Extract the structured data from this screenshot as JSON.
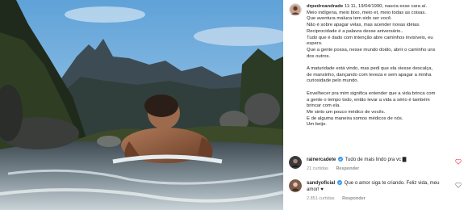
{
  "post": {
    "username": "drpedroandrade",
    "caption_lines": [
      "11:11, 19/04/1990, nascia esse cara aí.",
      "Meio indígena, meio bixo, meio et, meio todas as coisas.",
      "Que aventura maluca tem sido ser você.",
      "Não é sobre apagar velas, mas acender novas idéias.",
      "Reciprocidade é a palavra desse aniversário..",
      "Tudo que é dado com intenção abre caminhos invisíveis, eu",
      "espero.",
      "Que a gente possa, nesse mundo doido, abrir o caminho uns",
      "dos outros.",
      "",
      "A maturidade está vindo, mas pedi que ela viesse descalça,",
      "de mansinho, dançando com leveza e sem apagar a minha",
      "curiosidade pelo mundo.",
      "",
      "Envelhecer pra mim significa entender que a vida brinca com",
      "a gente o tempo todo, então levar a vida a sério é também",
      "brincar com ela.",
      "Me sinto um pouco médico de vocês.",
      "E de alguma maneira somos médicos de nós.",
      "Um beijo."
    ]
  },
  "comments": [
    {
      "username": "rainercadete",
      "verified": true,
      "text": "Tudo de mais lindo pra vc ▇",
      "likes": "21 curtidas",
      "reply_label": "Responder",
      "heart_color": "#ed4956",
      "avatar_color": "#3a3a3a"
    },
    {
      "username": "sandyoficial",
      "verified": true,
      "text": "Que o amor siga te criando. Feliz vida, meu amor! ♥",
      "likes": "2.851 curtidas",
      "reply_label": "Responder",
      "heart_color": "#8e8e8e",
      "avatar_color": "#7a5a48"
    }
  ],
  "colors": {
    "verified_badge": "#3897f0",
    "muted_text": "#8e8e8e"
  }
}
